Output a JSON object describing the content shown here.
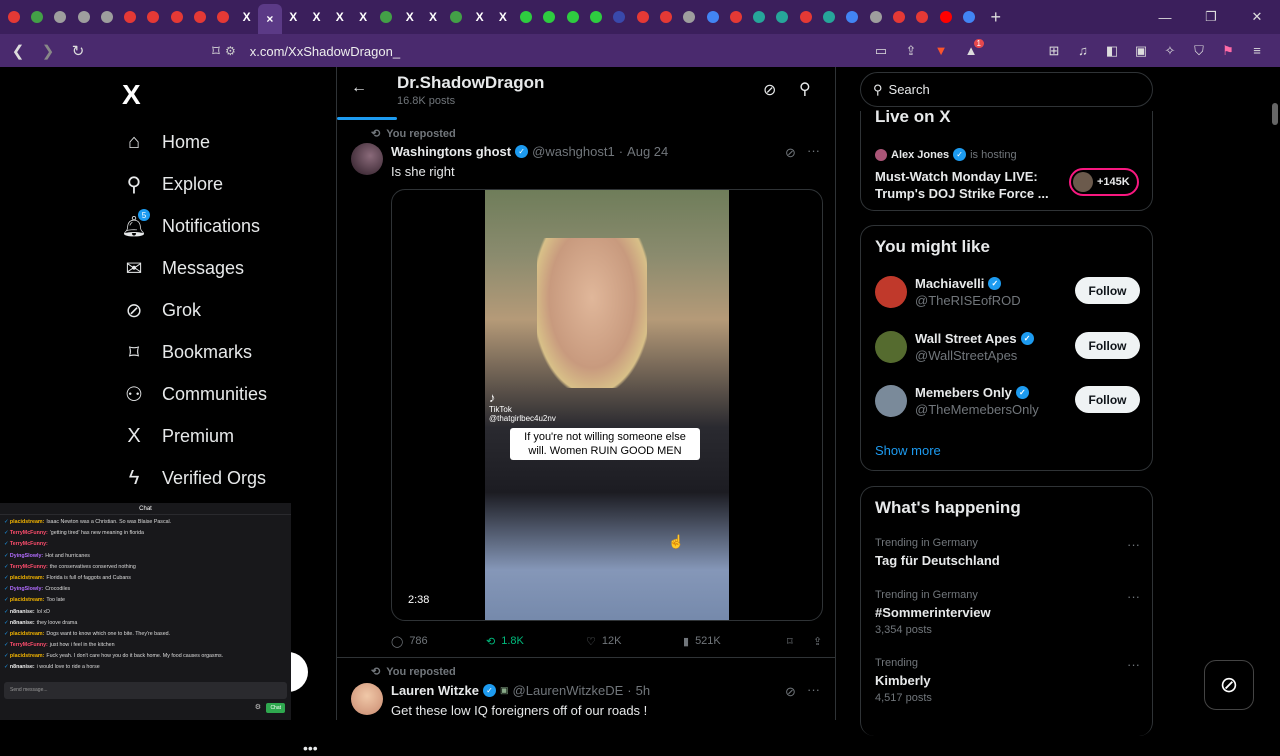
{
  "browser": {
    "tabs": [
      {
        "color": "#e53935",
        "active": false
      },
      {
        "color": "#43a047",
        "active": false
      },
      {
        "color": "#9e9e9e",
        "active": false
      },
      {
        "color": "#9e9e9e",
        "active": false
      },
      {
        "color": "#9e9e9e",
        "active": false
      },
      {
        "color": "#e53935",
        "active": false
      },
      {
        "color": "#e53935",
        "active": false
      },
      {
        "color": "#e53935",
        "active": false
      },
      {
        "color": "#e53935",
        "active": false
      },
      {
        "color": "#e53935",
        "active": false
      },
      {
        "color": "#000000",
        "active": false,
        "glyph": "X"
      },
      {
        "color": "#5b3a86",
        "active": true,
        "glyph": "×"
      },
      {
        "color": "#000000",
        "active": false,
        "glyph": "X"
      },
      {
        "color": "#000000",
        "active": false,
        "glyph": "X"
      },
      {
        "color": "#000000",
        "active": false,
        "glyph": "X"
      },
      {
        "color": "#000000",
        "active": false,
        "glyph": "X"
      },
      {
        "color": "#43a047",
        "active": false
      },
      {
        "color": "#000000",
        "active": false,
        "glyph": "X"
      },
      {
        "color": "#000000",
        "active": false,
        "glyph": "X"
      },
      {
        "color": "#43a047",
        "active": false
      },
      {
        "color": "#000000",
        "active": false,
        "glyph": "X"
      },
      {
        "color": "#000000",
        "active": false,
        "glyph": "X"
      },
      {
        "color": "#2ecc40",
        "active": false
      },
      {
        "color": "#2ecc40",
        "active": false
      },
      {
        "color": "#2ecc40",
        "active": false
      },
      {
        "color": "#2ecc40",
        "active": false
      },
      {
        "color": "#3949ab",
        "active": false
      },
      {
        "color": "#e53935",
        "active": false
      },
      {
        "color": "#e53935",
        "active": false
      },
      {
        "color": "#9e9e9e",
        "active": false
      },
      {
        "color": "#4285f4",
        "active": false
      },
      {
        "color": "#e53935",
        "active": false
      },
      {
        "color": "#26a69a",
        "active": false
      },
      {
        "color": "#26a69a",
        "active": false
      },
      {
        "color": "#e53935",
        "active": false
      },
      {
        "color": "#26a69a",
        "active": false
      },
      {
        "color": "#4285f4",
        "active": false
      },
      {
        "color": "#9e9e9e",
        "active": false
      },
      {
        "color": "#e53935",
        "active": false
      },
      {
        "color": "#e53935",
        "active": false
      },
      {
        "color": "#ff0000",
        "active": false
      },
      {
        "color": "#4285f4",
        "active": false
      }
    ],
    "new_tab": "+",
    "url": "x.com/XxShadowDragon_"
  },
  "nav": {
    "items": [
      {
        "label": "Home",
        "icon": "⌂",
        "name": "home"
      },
      {
        "label": "Explore",
        "icon": "⚲",
        "name": "explore"
      },
      {
        "label": "Notifications",
        "icon": "🔔︎",
        "name": "notifications"
      },
      {
        "label": "Messages",
        "icon": "✉",
        "name": "messages"
      },
      {
        "label": "Grok",
        "icon": "⊘",
        "name": "grok"
      },
      {
        "label": "Bookmarks",
        "icon": "⌑",
        "name": "bookmarks"
      },
      {
        "label": "Communities",
        "icon": "⚇",
        "name": "communities"
      },
      {
        "label": "Premium",
        "icon": "X",
        "name": "premium"
      },
      {
        "label": "Verified Orgs",
        "icon": "ϟ",
        "name": "verified-orgs"
      }
    ],
    "notif_count": "5"
  },
  "chat": {
    "title": "Chat",
    "messages": [
      {
        "user": "placidstream:",
        "text": "Isaac Newton was a Christian. So was Blaise Pascal.",
        "color": "#f2b400"
      },
      {
        "user": "TerryMcFunny:",
        "text": "'getting tired' has new meaning in florida",
        "color": "#ff4d6d"
      },
      {
        "user": "TerryMcFunny:",
        "text": "",
        "color": "#ff4d6d"
      },
      {
        "user": "DyingSlowly:",
        "text": "Hot and hurricanes",
        "color": "#b26cff"
      },
      {
        "user": "TerryMcFunny:",
        "text": "the conservatives conserved nothing",
        "color": "#ff4d6d"
      },
      {
        "user": "placidstream:",
        "text": "Florida is full of faggots and Cubans",
        "color": "#f2b400"
      },
      {
        "user": "DyingSlowly:",
        "text": "Crocodiles",
        "color": "#b26cff"
      },
      {
        "user": "placidstream:",
        "text": "Too late",
        "color": "#f2b400"
      },
      {
        "user": "n8nanise:",
        "text": "lol xD",
        "color": "#eeeeee"
      },
      {
        "user": "n8nanise:",
        "text": "they loove drama",
        "color": "#eeeeee"
      },
      {
        "user": "placidstream:",
        "text": "Dogs want to know which one to bite. They're based.",
        "color": "#f2b400"
      },
      {
        "user": "TerryMcFunny:",
        "text": "just how i feel in the kitchen",
        "color": "#ff4d6d"
      },
      {
        "user": "placidstream:",
        "text": "Fuck yeah. I don't care how you do it back home. My food causes orgasms.",
        "color": "#f2b400"
      },
      {
        "user": "n8nanise:",
        "text": "i would love to ride a horse",
        "color": "#eeeeee"
      }
    ],
    "input_placeholder": "Send message...",
    "send_label": "Chat"
  },
  "profile": {
    "name": "Dr.ShadowDragon",
    "posts": "16.8K posts"
  },
  "tweet1": {
    "repost_label": "You reposted",
    "display_name": "Washingtons ghost",
    "handle": "@washghost1",
    "sep": "·",
    "date": "Aug 24",
    "text": "Is she right",
    "video": {
      "caption": "If you're not willing someone else will. Women RUIN GOOD MEN",
      "tiktok": "TikTok",
      "tiktok_handle": "@thatgirlbec4u2nv",
      "duration": "2:38"
    },
    "replies": "786",
    "reposts": "1.8K",
    "likes": "12K",
    "views": "521K"
  },
  "tweet2": {
    "repost_label": "You reposted",
    "display_name": "Lauren Witzke",
    "handle": "@LaurenWitzkeDE",
    "sep": "·",
    "date": "5h",
    "text": "Get these low IQ foreigners off of our roads !"
  },
  "right": {
    "search_placeholder": "Search",
    "live": {
      "title": "Live on X",
      "host": "Alex Jones",
      "hosting": "is hosting",
      "stream_title": "Must-Watch Monday LIVE: Trump's DOJ Strike Force ...",
      "listeners": "+145K"
    },
    "might_like": {
      "title": "You might like",
      "users": [
        {
          "name": "Machiavelli",
          "handle": "@TheRISEofROD",
          "follow": "Follow",
          "color": "#c0392b"
        },
        {
          "name": "Wall Street Apes",
          "handle": "@WallStreetApes",
          "follow": "Follow",
          "color": "#556b2f"
        },
        {
          "name": "Memebers Only",
          "handle": "@TheMemebersOnly",
          "follow": "Follow",
          "color": "#7a8a9a"
        }
      ],
      "show_more": "Show more"
    },
    "happening": {
      "title": "What's happening",
      "trends": [
        {
          "context": "Trending in Germany",
          "name": "Tag für Deutschland",
          "posts": ""
        },
        {
          "context": "Trending in Germany",
          "name": "#Sommerinterview",
          "posts": "3,354 posts"
        },
        {
          "context": "Trending",
          "name": "Kimberly",
          "posts": "4,517 posts"
        }
      ]
    }
  }
}
